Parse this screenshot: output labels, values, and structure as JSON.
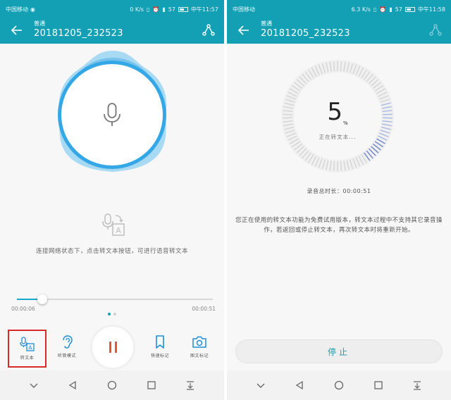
{
  "colors": {
    "accent": "#13a0b5",
    "mic_ring": "#34a8e6",
    "highlight_box": "#d92a2a",
    "pause": "#e05a2b"
  },
  "left_screen": {
    "status_bar": {
      "carrier": "中国移动",
      "net_speed": "0 K/s",
      "battery": "57",
      "time": "中午11:57"
    },
    "header": {
      "subtitle": "普通",
      "title": "20181205_232523"
    },
    "mic_icon": "microphone-icon",
    "hint": "连接网络状态下，点击转文本按钮，可进行语音转文本",
    "playback": {
      "current": "00:00:06",
      "total": "00:00:51",
      "progress": 0.13
    },
    "toolbar": {
      "transcribe_label": "转文本",
      "listen_label": "听筒模式",
      "bookmark_label": "快速标记",
      "photo_label": "图文标记"
    }
  },
  "right_screen": {
    "status_bar": {
      "carrier": "中国移动",
      "net_speed": "6.3 K/s",
      "battery": "57",
      "time": "中午11:58"
    },
    "header": {
      "subtitle": "普通",
      "title": "20181205_232523"
    },
    "progress_percent": "5",
    "percent_sign": "%",
    "status": "正在转文本...",
    "duration_label": "录音总时长：00:00:51",
    "notice": "您正在使用的转文本功能为免费试用版本，转文本过程中不支持其它录音操作，若返回或停止转文本，再次转文本时将重新开始。",
    "stop_label": "停止"
  }
}
